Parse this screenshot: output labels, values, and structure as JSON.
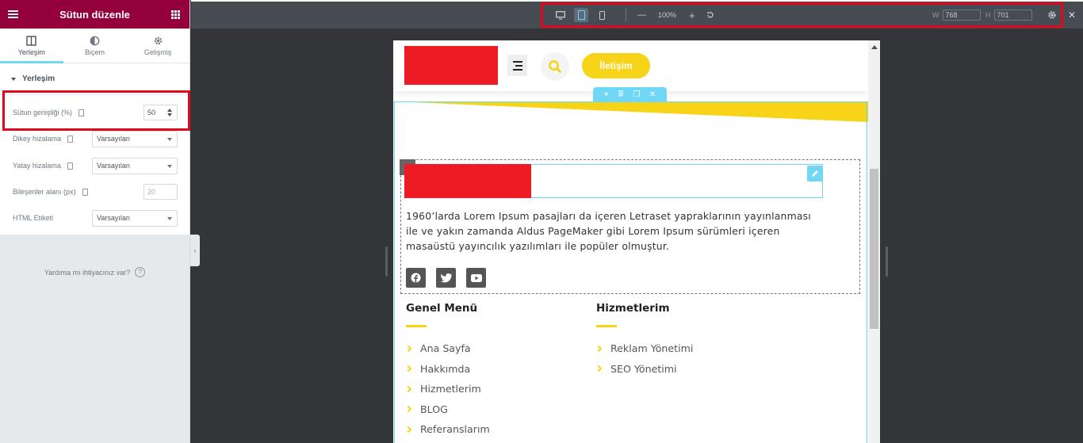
{
  "panel": {
    "title": "Sütun düzenle",
    "tabs": [
      {
        "label": "Yerleşim",
        "icon": "columns-icon"
      },
      {
        "label": "Biçem",
        "icon": "half-circle-icon"
      },
      {
        "label": "Gelişmiş",
        "icon": "gear-icon"
      }
    ],
    "section_title": "Yerleşim",
    "controls": {
      "column_width_label": "Sütun genişliği (%)",
      "column_width_value": "50",
      "vertical_align_label": "Dikey hizalama",
      "vertical_align_value": "Varsayılan",
      "horizontal_align_label": "Yatay hizalama",
      "horizontal_align_value": "Varsayılan",
      "widget_gap_label": "Bileşenler alanı (px)",
      "widget_gap_value": "20",
      "html_tag_label": "HTML Etiketi",
      "html_tag_value": "Varsayılan"
    },
    "help_text": "Yardıma mı ihtiyacınız var?",
    "help_icon": "?",
    "collapse_icon": "‹"
  },
  "topbar": {
    "zoom_minus": "—",
    "zoom": "100%",
    "zoom_plus": "+",
    "width_label": "W",
    "width_value": "768",
    "height_label": "H",
    "height_value": "701",
    "close_icon": "✕"
  },
  "site": {
    "cta_label": "İletişim",
    "section_tools": [
      "+",
      "⠿",
      "❐",
      "✕"
    ],
    "body_text": "1960’larda Lorem Ipsum pasajları da içeren Letraset yapraklarının yayınlanması ile ve yakın zamanda Aldus PageMaker gibi Lorem Ipsum sürümleri içeren masaüstü yayıncılık yazılımları ile popüler olmuştur.",
    "social": [
      "facebook-icon",
      "twitter-icon",
      "youtube-icon"
    ],
    "menu1": {
      "title": "Genel Menü",
      "items": [
        "Ana Sayfa",
        "Hakkımda",
        "Hizmetlerim",
        "BLOG",
        "Referanslarım"
      ]
    },
    "menu2": {
      "title": "Hizmetlerim",
      "items": [
        "Reklam Yönetimi",
        "SEO Yönetimi"
      ]
    }
  },
  "colors": {
    "panel_header": "#93003c",
    "accent_blue": "#71d7f7",
    "brand_yellow": "#f7d417",
    "logo_red": "#ed1c24",
    "highlight_red": "#e40520"
  }
}
